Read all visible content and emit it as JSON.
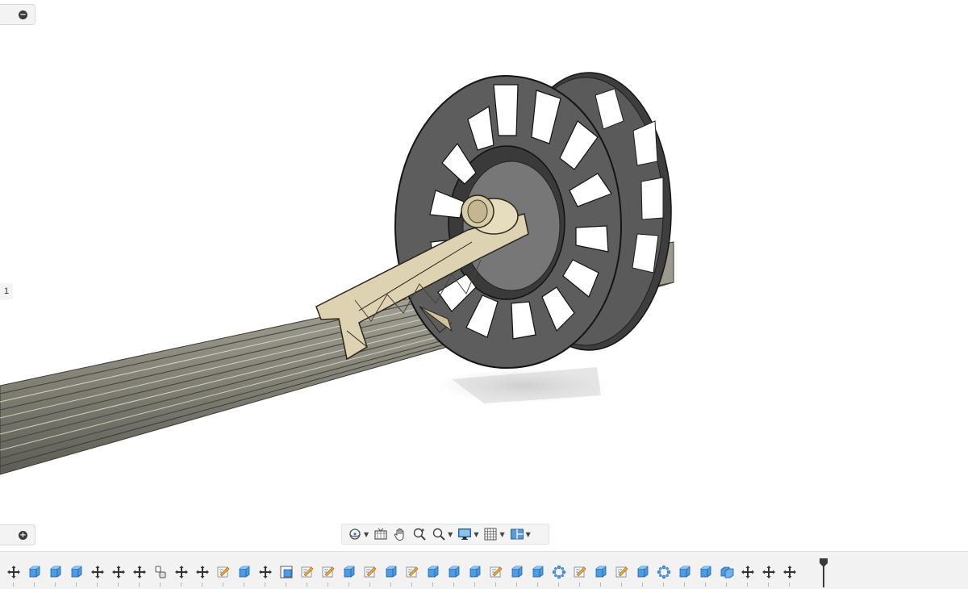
{
  "browser_panel": {
    "toggle_icon": "minus-circle-icon"
  },
  "comments_panel": {
    "toggle_icon": "plus-circle-icon"
  },
  "side_label": "1",
  "model": {
    "components": [
      "spool",
      "spool-holder-arm",
      "aluminum-extrusion-rail"
    ],
    "colors": {
      "spool": "#5c5c5c",
      "holder": "#d9ccaa",
      "rail": "#8a887a"
    }
  },
  "navigation_toolbar": {
    "buttons": [
      {
        "name": "orbit",
        "icon": "orbit-icon",
        "dropdown": true
      },
      {
        "name": "look-at",
        "icon": "look-at-icon",
        "dropdown": false
      },
      {
        "name": "pan",
        "icon": "pan-hand-icon",
        "dropdown": false
      },
      {
        "name": "zoom",
        "icon": "zoom-icon",
        "dropdown": false
      },
      {
        "name": "fit",
        "icon": "zoom-window-icon",
        "dropdown": true
      },
      {
        "name": "display-settings",
        "icon": "display-settings-icon",
        "dropdown": true
      },
      {
        "name": "grid-snaps",
        "icon": "grid-icon",
        "dropdown": true
      },
      {
        "name": "viewports",
        "icon": "viewports-icon",
        "dropdown": true
      }
    ]
  },
  "timeline": {
    "features": [
      "move",
      "body",
      "body",
      "body",
      "move",
      "move",
      "move",
      "joint",
      "move",
      "move",
      "sketch",
      "body",
      "move",
      "derive",
      "sketch",
      "sketch",
      "body",
      "sketch",
      "body",
      "sketch",
      "body",
      "body",
      "body",
      "sketch",
      "body",
      "body",
      "pattern",
      "sketch",
      "body",
      "sketch",
      "body",
      "pattern",
      "body",
      "body",
      "component",
      "move",
      "move",
      "move"
    ]
  }
}
